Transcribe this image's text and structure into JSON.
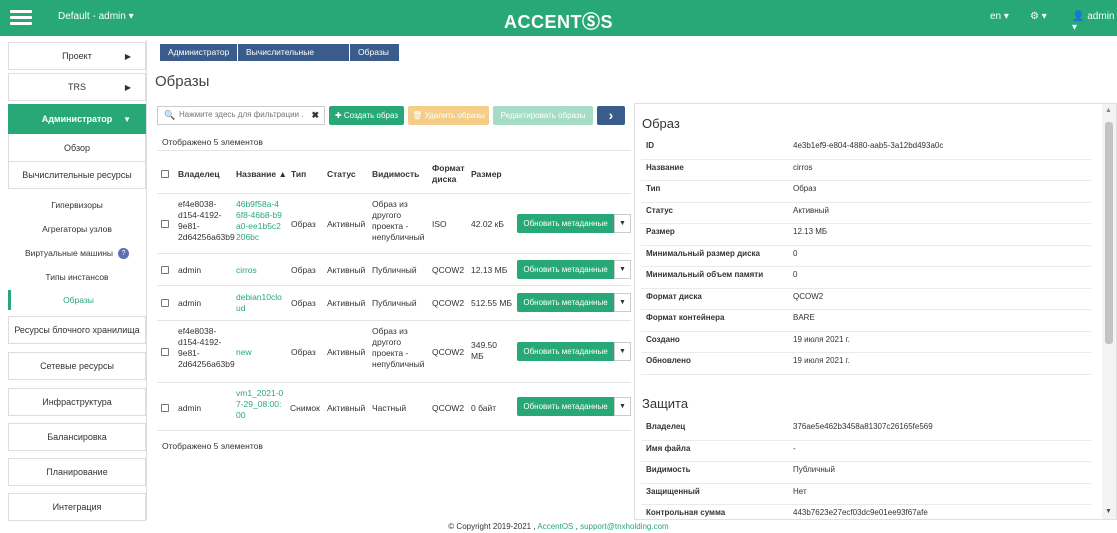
{
  "topbar": {
    "project_label": "Default - admin ▾",
    "brand": "ACCENTⓈS",
    "lang": "en ▾",
    "settings": "⚙ ▾",
    "user": "admin ▾",
    "accent": "#27a876"
  },
  "sidebar": {
    "project": "Проект",
    "trs": "TRS",
    "admin": "Администратор",
    "overview": "Обзор",
    "compute": "Вычислительные ресурсы",
    "hypervisors": "Гипервизоры",
    "aggregates": "Агрегаторы узлов",
    "vms": "Виртуальные машины",
    "vms_badge": "?",
    "flavors": "Типы инстансов",
    "images": "Образы",
    "block": "Ресурсы блочного хранилища",
    "network": "Сетевые ресурсы",
    "infra": "Инфраструктура",
    "balancing": "Балансировка",
    "planning": "Планирование",
    "integration": "Интеграция"
  },
  "breadcrumb": [
    "Администратор",
    "Вычислительные ресурсы",
    "Образы"
  ],
  "page_title": "Образы",
  "toolbar": {
    "filter_placeholder": "Нажмите здесь для фильтрации ...",
    "create": "✚ Создать образ",
    "delete": "🗑 Удалить образы",
    "edit": "Редактировать образы",
    "next": "›"
  },
  "table": {
    "count_top": "Отображено 5 элементов",
    "count_bottom": "Отображено 5 элементов",
    "headers": {
      "owner": "Владелец",
      "name": "Название ▲",
      "type": "Тип",
      "status": "Статус",
      "visibility": "Видимость",
      "format": "Формат диска",
      "size": "Размер"
    },
    "action_label": "Обновить метаданные",
    "rows": [
      {
        "owner": "ef4e8038-d154-4192-9e81-2d64256a63b9",
        "name": "46b9f58a-46f8-46b8-b9a0-ee1b5c2206bc",
        "type": "Образ",
        "status": "Активный",
        "visibility": "Образ из другого проекта - непубличный",
        "format": "ISO",
        "size": "42.02 кБ"
      },
      {
        "owner": "admin",
        "name": "cirros",
        "type": "Образ",
        "status": "Активный",
        "visibility": "Публичный",
        "format": "QCOW2",
        "size": "12.13 МБ"
      },
      {
        "owner": "admin",
        "name": "debian10cloud",
        "type": "Образ",
        "status": "Активный",
        "visibility": "Публичный",
        "format": "QCOW2",
        "size": "512.55 МБ"
      },
      {
        "owner": "ef4e8038-d154-4192-9e81-2d64256a63b9",
        "name": "new",
        "type": "Образ",
        "status": "Активный",
        "visibility": "Образ из другого проекта - непубличный",
        "format": "QCOW2",
        "size": "349.50 МБ"
      },
      {
        "owner": "admin",
        "name": "vm1_2021-07-29_08:00:00",
        "type": "Снимок",
        "status": "Активный",
        "visibility": "Частный",
        "format": "QCOW2",
        "size": "0 байт"
      }
    ]
  },
  "details": {
    "image_title": "Образ",
    "image_rows": [
      {
        "k": "ID",
        "v": "4e3b1ef9-e804-4880-aab5-3a12bd493a0c"
      },
      {
        "k": "Название",
        "v": "cirros"
      },
      {
        "k": "Тип",
        "v": "Образ"
      },
      {
        "k": "Статус",
        "v": "Активный"
      },
      {
        "k": "Размер",
        "v": "12.13 МБ"
      },
      {
        "k": "Минимальный размер диска",
        "v": "0"
      },
      {
        "k": "Минимальный объем памяти",
        "v": "0"
      },
      {
        "k": "Формат диска",
        "v": "QCOW2"
      },
      {
        "k": "Формат контейнера",
        "v": "BARE"
      },
      {
        "k": "Создано",
        "v": "19 июля 2021 г."
      },
      {
        "k": "Обновлено",
        "v": "19 июля 2021 г."
      }
    ],
    "security_title": "Защита",
    "security_rows": [
      {
        "k": "Владелец",
        "v": "376ae5e462b3458a81307c26165fe569"
      },
      {
        "k": "Имя файла",
        "v": "-"
      },
      {
        "k": "Видимость",
        "v": "Публичный"
      },
      {
        "k": "Защищенный",
        "v": "Нет"
      },
      {
        "k": "Контрольная сумма",
        "v": "443b7623e27ecf03dc9e01ee93f67afe"
      }
    ]
  },
  "footer": {
    "copyright": "© Copyright 2019-2021 ,",
    "product": "AccentOS",
    "sep": ",",
    "email": "support@tnxholding.com"
  }
}
